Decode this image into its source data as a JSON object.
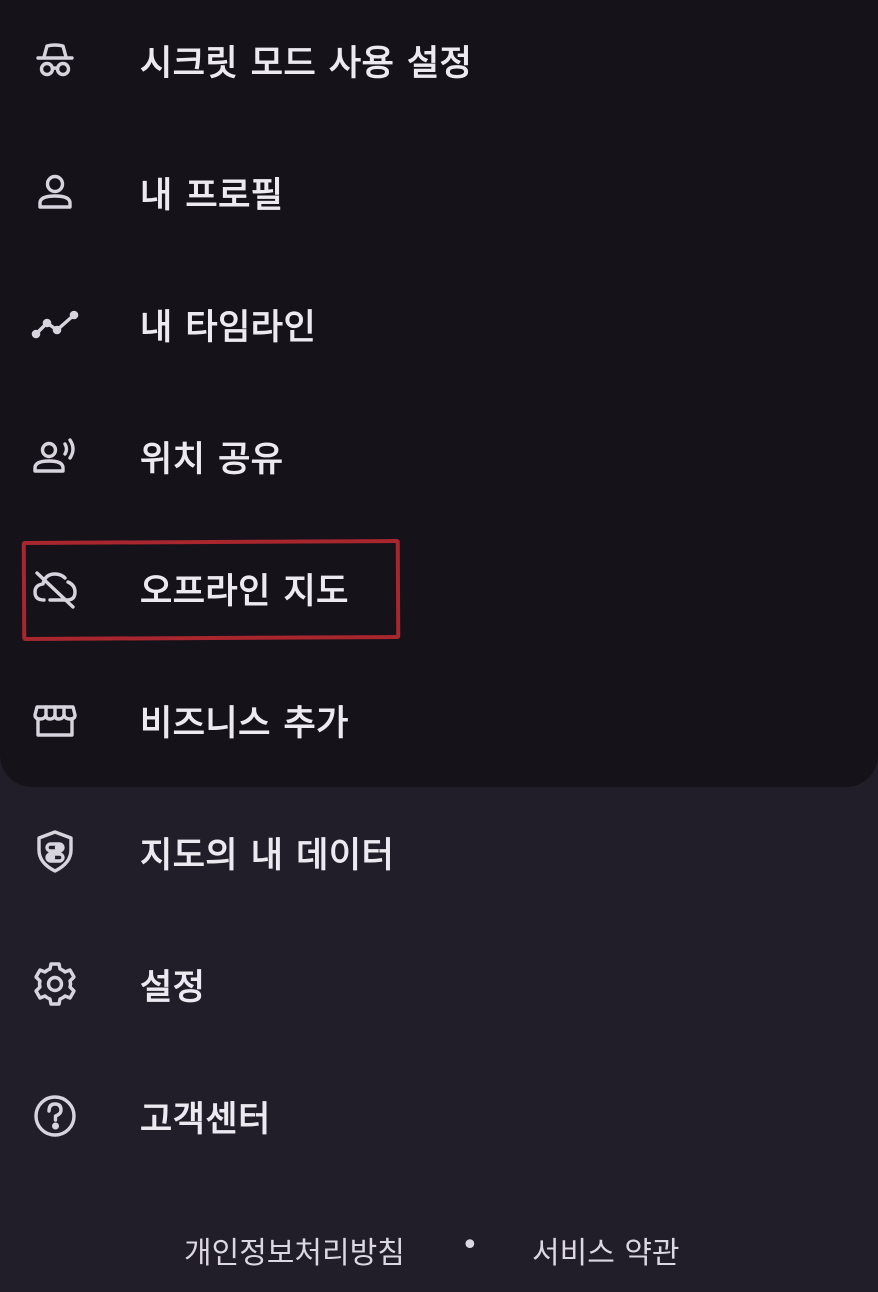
{
  "menu": {
    "items": [
      {
        "label": "시크릿 모드 사용 설정",
        "icon": "incognito-icon"
      },
      {
        "label": "내 프로필",
        "icon": "person-icon"
      },
      {
        "label": "내 타임라인",
        "icon": "timeline-icon"
      },
      {
        "label": "위치 공유",
        "icon": "location-sharing-icon"
      },
      {
        "label": "오프라인 지도",
        "icon": "cloud-off-icon"
      },
      {
        "label": "비즈니스 추가",
        "icon": "storefront-icon"
      },
      {
        "label": "지도의 내 데이터",
        "icon": "shield-data-icon"
      },
      {
        "label": "설정",
        "icon": "gear-icon"
      },
      {
        "label": "고객센터",
        "icon": "help-icon"
      }
    ]
  },
  "footer": {
    "privacy_label": "개인정보처리방침",
    "separator": "•",
    "terms_label": "서비스 약관"
  },
  "colors": {
    "top_panel": "#16121a",
    "background": "#221e29",
    "highlight": "#a8262d"
  }
}
